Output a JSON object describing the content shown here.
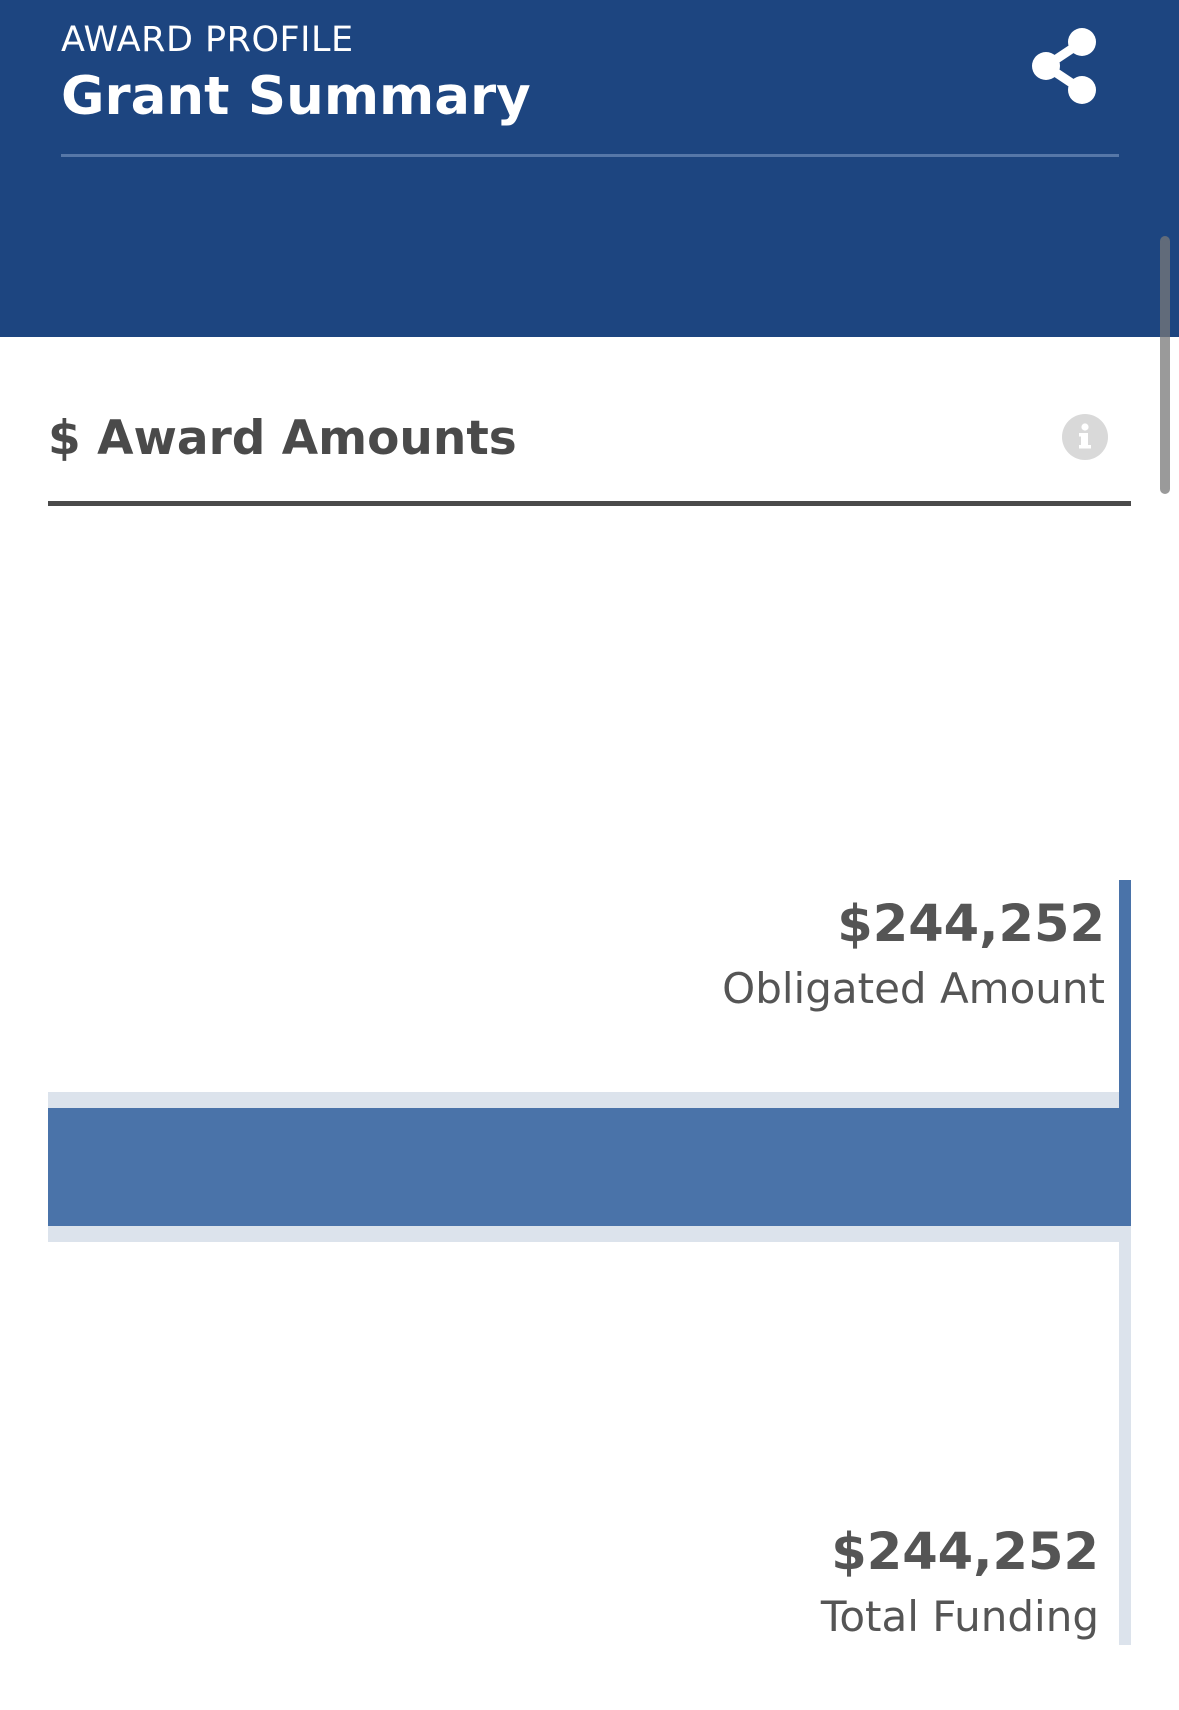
{
  "header": {
    "eyebrow": "AWARD PROFILE",
    "title": "Grant Summary",
    "share_icon": "share-icon",
    "background_color": "#1d4580"
  },
  "section": {
    "title": "$ Award Amounts",
    "info_icon": "info-icon"
  },
  "award_amounts": {
    "obligated": {
      "amount": "$244,252",
      "label": "Obligated Amount",
      "value": 244252
    },
    "total_funding": {
      "amount": "$244,252",
      "label": "Total Funding",
      "value": 244252
    },
    "colors": {
      "obligated_bar": "#4a73a9",
      "total_bar": "#dce3ec"
    }
  }
}
